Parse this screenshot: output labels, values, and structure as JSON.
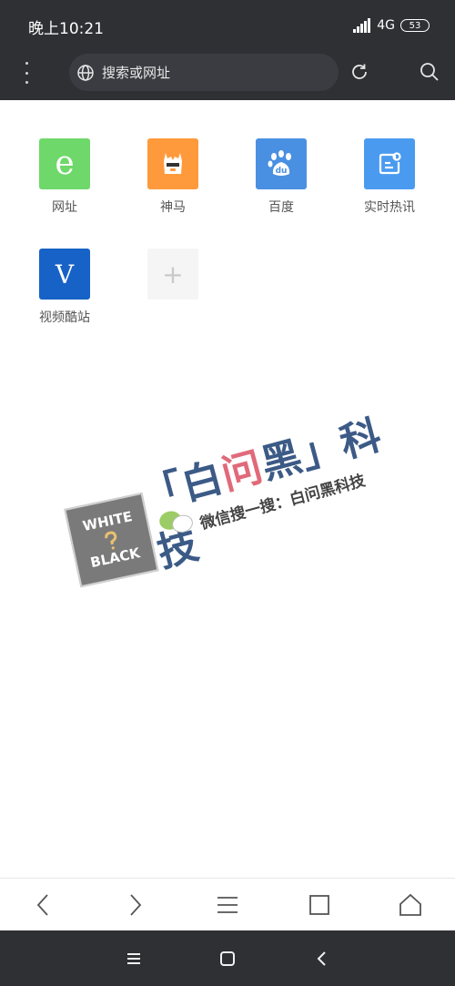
{
  "status": {
    "time": "晚上10:21",
    "network": "4G",
    "battery": "53"
  },
  "toolbar": {
    "search_placeholder": "搜索或网址"
  },
  "shortcuts": [
    {
      "label": "网址",
      "icon": "e-icon",
      "glyph": "e"
    },
    {
      "label": "神马",
      "icon": "shenma-icon",
      "glyph": ""
    },
    {
      "label": "百度",
      "icon": "baidu-paw-icon",
      "glyph": "du"
    },
    {
      "label": "实时热讯",
      "icon": "hot-news-icon",
      "glyph": ""
    },
    {
      "label": "视频酷站",
      "icon": "v-icon",
      "glyph": "V"
    },
    {
      "label": "",
      "icon": "add-icon",
      "glyph": "+"
    }
  ],
  "watermark": {
    "badge_top": "WHITE",
    "badge_bottom": "BLACK",
    "title_left": "「白",
    "title_red": "问",
    "title_right": "黑」科技",
    "subtitle": "微信搜一搜：白问黑科技"
  },
  "colors": {
    "toolbar_bg": "#2f3034",
    "accent_blue": "#4a90e2"
  }
}
